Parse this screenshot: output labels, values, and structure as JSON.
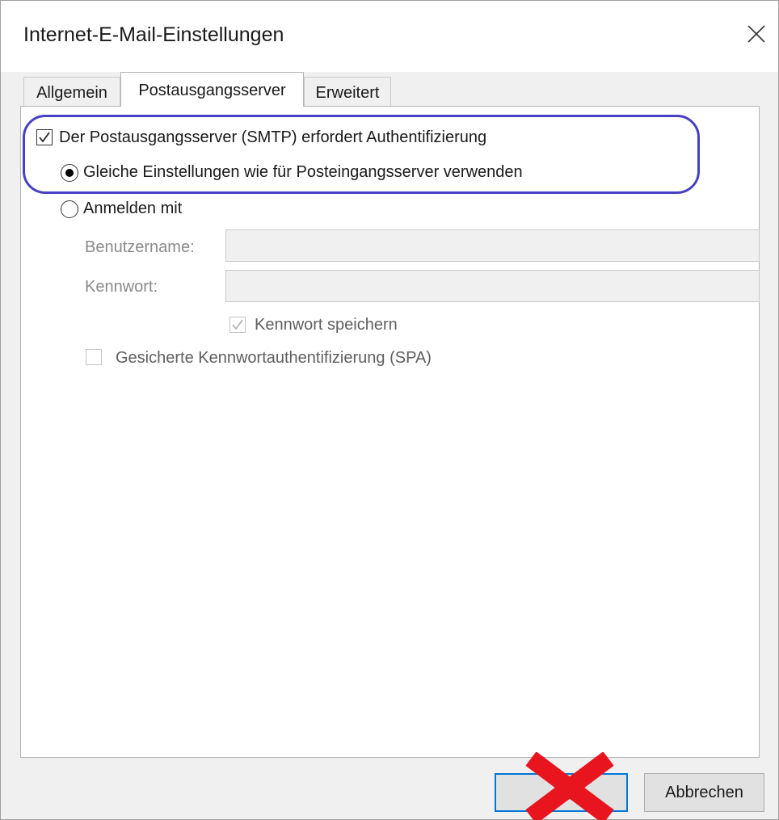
{
  "window": {
    "title": "Internet-E-Mail-Einstellungen"
  },
  "tabs": [
    {
      "label": "Allgemein",
      "active": false
    },
    {
      "label": "Postausgangsserver",
      "active": true
    },
    {
      "label": "Erweitert",
      "active": false
    }
  ],
  "smtp_auth": {
    "label": "Der Postausgangsserver (SMTP) erfordert Authentifizierung",
    "checked": true
  },
  "auth_options": {
    "same_settings": {
      "label": "Gleiche Einstellungen wie für Posteingangsserver verwenden",
      "selected": true
    },
    "login_with": {
      "label": "Anmelden mit",
      "selected": false
    }
  },
  "credentials": {
    "username_label": "Benutzername:",
    "username_value": "",
    "password_label": "Kennwort:",
    "password_value": "",
    "save_password": {
      "label": "Kennwort speichern",
      "checked": true,
      "enabled": false
    },
    "spa": {
      "label": "Gesicherte Kennwortauthentifizierung (SPA)",
      "checked": false,
      "enabled": false
    }
  },
  "buttons": {
    "ok_label": "",
    "cancel_label": "Abbrechen"
  },
  "colors": {
    "highlight": "#4740c4",
    "red_mark": "#e8141e",
    "focus_border": "#0078d7"
  }
}
